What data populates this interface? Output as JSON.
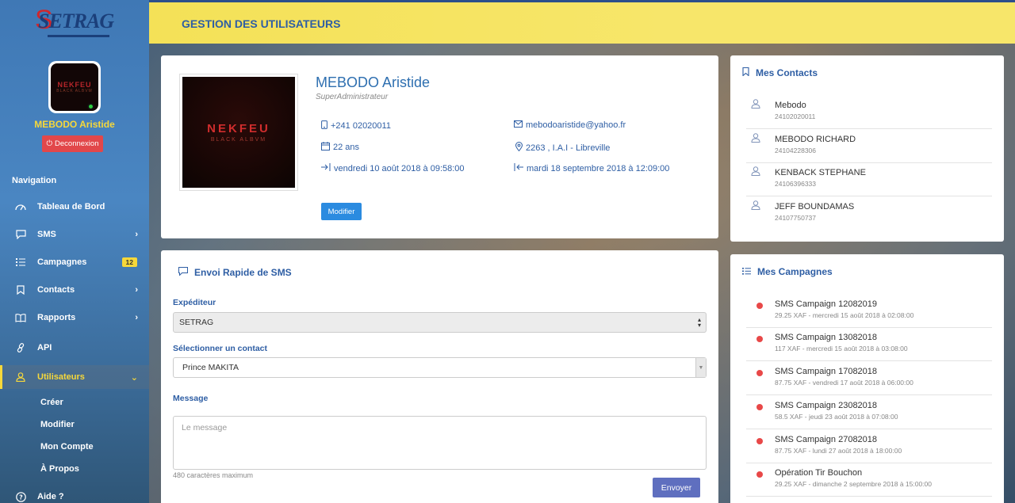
{
  "sidebar": {
    "logo": "SETRAG",
    "user_name": "MEBODO Aristide",
    "avatar_text_1": "NEKFEU",
    "avatar_text_2": "BLACK ALBVM",
    "logout_label": "Deconnexion",
    "nav_heading": "Navigation",
    "items": [
      {
        "label": "Tableau de Bord",
        "icon": "dashboard-icon"
      },
      {
        "label": "SMS",
        "icon": "chat-icon"
      },
      {
        "label": "Campagnes",
        "icon": "list-icon",
        "badge": "12"
      },
      {
        "label": "Contacts",
        "icon": "bookmark-icon"
      },
      {
        "label": "Rapports",
        "icon": "book-icon"
      },
      {
        "label": "API",
        "icon": "link-icon"
      },
      {
        "label": "Utilisateurs",
        "icon": "user-icon"
      },
      {
        "label": "Aide ?",
        "icon": "help-icon"
      }
    ],
    "sub_items": [
      "Créer",
      "Modifier",
      "Mon Compte",
      "À Propos"
    ]
  },
  "header": {
    "title": "GESTION DES UTILISATEURS"
  },
  "profile": {
    "name": "MEBODO Aristide",
    "role": "SuperAdministrateur",
    "phone": "+241 02020011",
    "email": "mebodoaristide@yahoo.fr",
    "age": "22 ans",
    "address": "2263 , I.A.I - Libreville",
    "login_time": "vendredi 10 août 2018 à 09:58:00",
    "logout_time": "mardi 18 septembre 2018 à 12:09:00",
    "modify_label": "Modifier",
    "album_title": "NEKFEU",
    "album_sub": "BLACK ALBVM"
  },
  "contacts": {
    "title": "Mes Contacts",
    "items": [
      {
        "name": "Mebodo",
        "number": "24102020011"
      },
      {
        "name": "MEBODO RICHARD",
        "number": "24104228306"
      },
      {
        "name": "KENBACK STEPHANE",
        "number": "24106396333"
      },
      {
        "name": "JEFF BOUNDAMAS",
        "number": "24107750737"
      }
    ]
  },
  "sms": {
    "title": "Envoi Rapide de SMS",
    "sender_label": "Expéditeur",
    "sender_value": "SETRAG",
    "contact_label": "Sélectionner un contact",
    "contact_value": "Prince MAKITA",
    "message_label": "Message",
    "message_placeholder": "Le message",
    "hint": "480 caractères maximum",
    "send_label": "Envoyer"
  },
  "campaigns": {
    "title": "Mes Campagnes",
    "items": [
      {
        "name": "SMS Campaign 12082019",
        "detail": "29.25 XAF - mercredi 15 août 2018 à 02:08:00"
      },
      {
        "name": "SMS Campaign 13082018",
        "detail": "117 XAF - mercredi 15 août 2018 à 03:08:00"
      },
      {
        "name": "SMS Campaign 17082018",
        "detail": "87.75 XAF - vendredi 17 août 2018 à 06:00:00"
      },
      {
        "name": "SMS Campaign 23082018",
        "detail": "58.5 XAF - jeudi 23 août 2018 à 07:08:00"
      },
      {
        "name": "SMS Campaign 27082018",
        "detail": "87.75 XAF - lundi 27 août 2018 à 18:00:00"
      },
      {
        "name": "Opération Tir Bouchon",
        "detail": "29.25 XAF - dimanche 2 septembre 2018 à 15:00:00"
      }
    ]
  },
  "colors": {
    "accent": "#2e5ea4",
    "header_bg": "#f4e157",
    "active": "#f7d83a",
    "danger": "#e2474a"
  }
}
